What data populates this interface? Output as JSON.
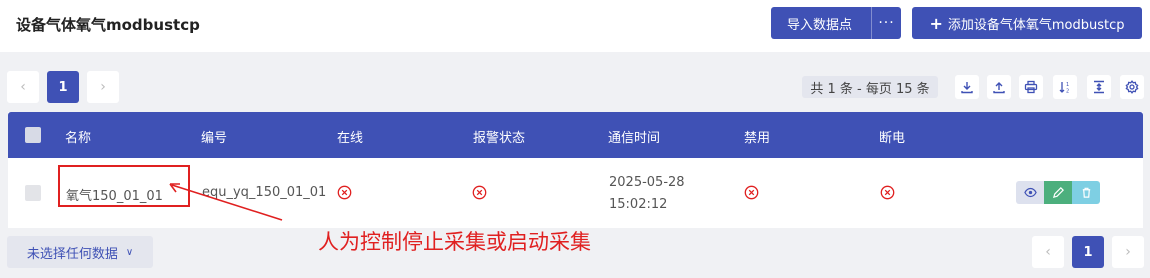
{
  "header": {
    "title": "设备气体氧气modbustcp",
    "import_label": "导入数据点",
    "more_label": "···",
    "add_label": "添加设备气体氧气modbustcp",
    "add_icon": "plus-icon"
  },
  "pagination_top": {
    "prev": "‹",
    "current": "1",
    "next": "›"
  },
  "summary": {
    "count_text": "共 1 条 - 每页 15 条"
  },
  "toolbar": {
    "icons": [
      "download-icon",
      "upload-icon",
      "print-icon",
      "sort-icon",
      "text-height-icon",
      "settings-icon"
    ]
  },
  "table": {
    "columns": [
      "名称",
      "编号",
      "在线",
      "报警状态",
      "通信时间",
      "禁用",
      "断电"
    ],
    "rows": [
      {
        "name": "氧气150_01_01",
        "code": "equ_yq_150_01_01",
        "online": "x-circle-icon",
        "alarm": "x-circle-icon",
        "comm_date": "2025-05-28",
        "comm_time": "15:02:12",
        "disabled": "x-circle-icon",
        "power_off": "x-circle-icon",
        "actions": [
          "view-icon",
          "edit-icon",
          "delete-icon"
        ]
      }
    ]
  },
  "bulk": {
    "label": "未选择任何数据"
  },
  "pagination_bottom": {
    "prev": "‹",
    "current": "1",
    "next": "›"
  },
  "annotation": {
    "text": "人为控制停止采集或启动采集"
  },
  "colors": {
    "primary": "#3f51b5",
    "danger": "#e02020",
    "edit": "#4caf7d",
    "delete": "#7ecfe3",
    "view_bg": "#dde1ee"
  }
}
